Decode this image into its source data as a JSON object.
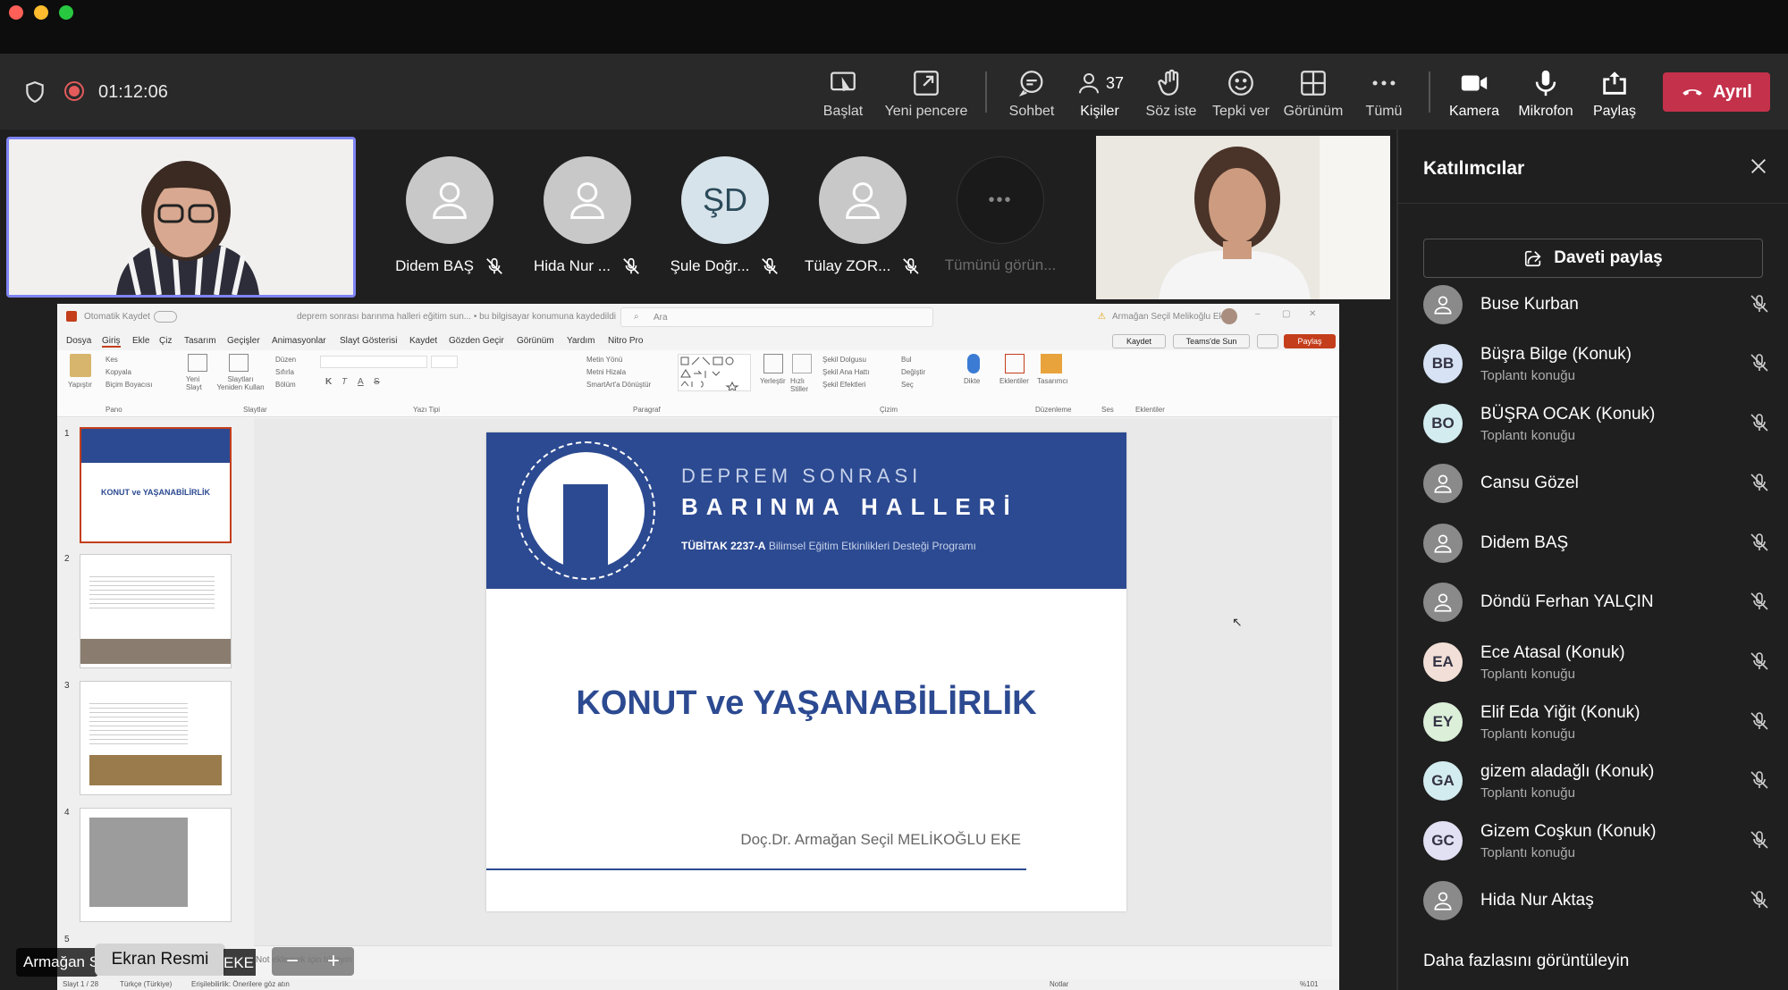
{
  "meeting": {
    "timer": "01:12:06",
    "people_count": "37"
  },
  "toolbar": {
    "baslat": "Başlat",
    "yeni_pencere": "Yeni pencere",
    "sohbet": "Sohbet",
    "kisiler": "Kişiler",
    "soz_iste": "Söz iste",
    "tepki_ver": "Tepki ver",
    "gorunum": "Görünüm",
    "tumu": "Tümü",
    "kamera": "Kamera",
    "mikrofon": "Mikrofon",
    "paylas": "Paylaş",
    "ayril": "Ayrıl"
  },
  "strip": {
    "tiles": [
      {
        "name": "Didem BAŞ",
        "initials": ""
      },
      {
        "name": "Hida Nur ...",
        "initials": ""
      },
      {
        "name": "Şule Doğr...",
        "initials": "ŞD"
      },
      {
        "name": "Tülay ZOR...",
        "initials": ""
      },
      {
        "name": "Tümünü görün...",
        "initials": "•••"
      }
    ]
  },
  "panel": {
    "title": "Katılımcılar",
    "invite": "Daveti paylaş",
    "more": "Daha fazlasını görüntüleyin",
    "participants": [
      {
        "name": "Buse Kurban",
        "sub": "",
        "initials": "",
        "color": "#8a8a8a"
      },
      {
        "name": "Büşra Bilge (Konuk)",
        "sub": "Toplantı konuğu",
        "initials": "BB",
        "color": "#d7e3f4"
      },
      {
        "name": "BÜŞRA OCAK (Konuk)",
        "sub": "Toplantı konuğu",
        "initials": "BO",
        "color": "#d3ecef"
      },
      {
        "name": "Cansu Gözel",
        "sub": "",
        "initials": "",
        "color": "#8a8a8a"
      },
      {
        "name": "Didem BAŞ",
        "sub": "",
        "initials": "",
        "color": "#8a8a8a"
      },
      {
        "name": "Döndü Ferhan YALÇIN",
        "sub": "",
        "initials": "",
        "color": "#8a8a8a"
      },
      {
        "name": "Ece Atasal (Konuk)",
        "sub": "Toplantı konuğu",
        "initials": "EA",
        "color": "#f2dfd7"
      },
      {
        "name": "Elif Eda Yiğit (Konuk)",
        "sub": "Toplantı konuğu",
        "initials": "EY",
        "color": "#dcefd9"
      },
      {
        "name": "gizem aladağlı (Konuk)",
        "sub": "Toplantı konuğu",
        "initials": "GA",
        "color": "#d3ecef"
      },
      {
        "name": "Gizem Coşkun (Konuk)",
        "sub": "Toplantı konuğu",
        "initials": "GC",
        "color": "#e2e0f3"
      },
      {
        "name": "Hida Nur Aktaş",
        "sub": "",
        "initials": "",
        "color": "#8a8a8a"
      }
    ]
  },
  "ppt": {
    "autosave": "Otomatik Kaydet",
    "doc_title": "deprem sonrası barınma halleri eğitim sun... • bu bilgisayar konumuna kaydedildi",
    "search": "Ara",
    "user": "Armağan Seçil Melikoğlu Eke",
    "tabs": [
      "Dosya",
      "Giriş",
      "Ekle",
      "Çiz",
      "Tasarım",
      "Geçişler",
      "Animasyonlar",
      "Slayt Gösterisi",
      "Kaydet",
      "Gözden Geçir",
      "Görünüm",
      "Yardım",
      "Nitro Pro"
    ],
    "kaydet_btn": "Kaydet",
    "teams_btn": "Teams'de Sun",
    "share_btn": "Paylaş",
    "groups": [
      "Pano",
      "Slaytlar",
      "Yazı Tipi",
      "Paragraf",
      "Çizim",
      "Düzenleme",
      "Ses",
      "Eklentiler"
    ],
    "ribbon": {
      "yapistir": "Yapıştır",
      "kes": "Kes",
      "kopyala": "Kopyala",
      "bicim": "Biçim Boyacısı",
      "yeni_slayt": "Yeni Slayt",
      "yeniden": "Slaytları Yeniden Kullan",
      "duzen": "Düzen",
      "sifirla": "Sıfırla",
      "bolum": "Bölüm",
      "metin_yonu": "Metin Yönü",
      "metni_hizala": "Metni Hizala",
      "smartart": "SmartArt'a Dönüştür",
      "yerlestir": "Yerleştir",
      "hizli": "Hızlı Stiller",
      "sekil_dolgusu": "Şekil Dolgusu",
      "sekil_ana": "Şekil Ana Hattı",
      "sekil_efekt": "Şekil Efektleri",
      "bul": "Bul",
      "degistir": "Değiştir",
      "sec": "Seç",
      "dikte": "Dikte",
      "eklentiler": "Eklentiler",
      "tasarimci": "Tasarımcı"
    },
    "slide": {
      "small_title": "DEPREM SONRASI",
      "big_title": "BARINMA HALLERİ",
      "tubitak": "TÜBİTAK 2237-A",
      "program": "Bilimsel Eğitim Etkinlikleri Desteği Programı",
      "main_title": "KONUT ve YAŞANABİLİRLİK",
      "author": "Doç.Dr. Armağan Seçil MELİKOĞLU EKE"
    },
    "thumbs": [
      "1",
      "2",
      "3",
      "4",
      "5"
    ],
    "thumb1_title": "KONUT ve YAŞANABİLİRLİK",
    "notes": "Not eklemek için tıklayın",
    "status_slide": "Slayt 1 / 28",
    "status_lang": "Türkçe (Türkiye)",
    "status_access": "Erişilebilirlik: Önerilere göz atın",
    "status_notes": "Notlar",
    "status_zoom": "%101"
  },
  "overlays": {
    "presenter": "Armağan S",
    "screenshot": "Ekran Resmi",
    "eke": "EKE"
  }
}
